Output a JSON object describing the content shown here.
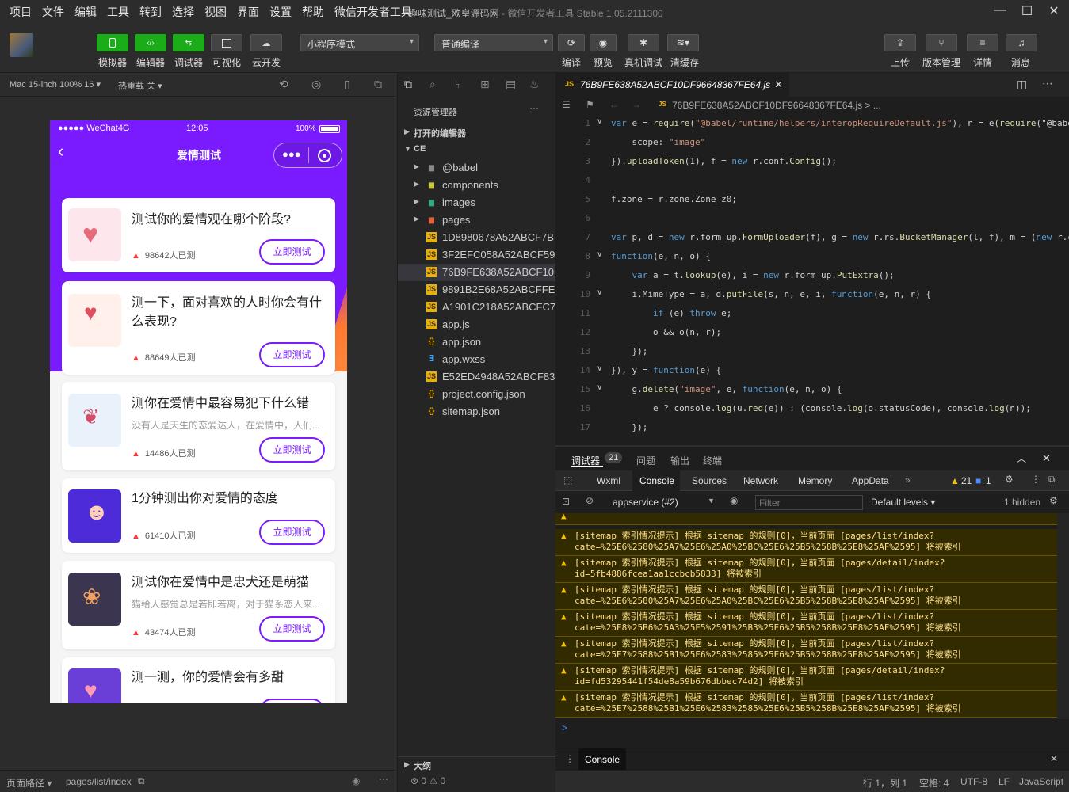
{
  "menu": [
    "项目",
    "文件",
    "编辑",
    "工具",
    "转到",
    "选择",
    "视图",
    "界面",
    "设置",
    "帮助",
    "微信开发者工具"
  ],
  "window": {
    "title": "趣味测试_欧皇源码网",
    "subtitle": " - 微信开发者工具 Stable 1.05.2111300"
  },
  "toolbar": {
    "left": [
      "模拟器",
      "编辑器",
      "调试器",
      "可视化",
      "云开发"
    ],
    "mode": "小程序模式",
    "compile_mode": "普通编译",
    "mid": [
      "编译",
      "预览",
      "真机调试",
      "清缓存"
    ],
    "right": [
      "上传",
      "版本管理",
      "详情",
      "消息"
    ]
  },
  "simbar": {
    "device": "Mac 15-inch 100% 16 ▾",
    "hotreload": "热重载 关 ▾"
  },
  "phone": {
    "carrier": "●●●●● WeChat4G",
    "time": "12:05",
    "battery": "100%",
    "nav_title": "爱情测试",
    "cards": [
      {
        "title": "测试你的爱情观在哪个阶段?",
        "sub": "",
        "count": "98642人已测",
        "btn": "立即测试"
      },
      {
        "title": "测一下，面对喜欢的人时你会有什么表现?",
        "sub": "",
        "count": "88649人已测",
        "btn": "立即测试"
      },
      {
        "title": "测你在爱情中最容易犯下什么错",
        "sub": "没有人是天生的恋爱达人，在爱情中，人们...",
        "count": "14486人已测",
        "btn": "立即测试"
      },
      {
        "title": "1分钟测出你对爱情的态度",
        "sub": "",
        "count": "61410人已测",
        "btn": "立即测试"
      },
      {
        "title": "测试你在爱情中是忠犬还是萌猫",
        "sub": "猫给人感觉总是若即若离，对于猫系恋人来...",
        "count": "43474人已测",
        "btn": "立即测试"
      },
      {
        "title": "测一测，你的爱情会有多甜",
        "sub": "",
        "count": "",
        "btn": ""
      }
    ]
  },
  "simfoot": {
    "label": "页面路径 ▾",
    "path": "pages/list/index"
  },
  "explorer": {
    "title": "资源管理器",
    "open_editors": "打开的编辑器",
    "root": "CE",
    "items": [
      {
        "name": "@babel",
        "type": "folder"
      },
      {
        "name": "components",
        "type": "folder"
      },
      {
        "name": "images",
        "type": "folder"
      },
      {
        "name": "pages",
        "type": "folder"
      },
      {
        "name": "1D8980678A52ABCF7B...",
        "type": "js"
      },
      {
        "name": "3F2EFC058A52ABCF59...",
        "type": "js"
      },
      {
        "name": "76B9FE638A52ABCF10...",
        "type": "js"
      },
      {
        "name": "9891B2E68A52ABCFFE...",
        "type": "js"
      },
      {
        "name": "A1901C218A52ABCFC7...",
        "type": "js"
      },
      {
        "name": "app.js",
        "type": "js"
      },
      {
        "name": "app.json",
        "type": "json"
      },
      {
        "name": "app.wxss",
        "type": "wxss"
      },
      {
        "name": "E52ED4948A52ABCF83...",
        "type": "js"
      },
      {
        "name": "project.config.json",
        "type": "json"
      },
      {
        "name": "sitemap.json",
        "type": "json"
      }
    ],
    "outline": "大纲",
    "status": "⊗ 0 ⚠ 0"
  },
  "editor": {
    "tab": "76B9FE638A52ABCF10DF96648367FE64.js",
    "crumb": "76B9FE638A52ABCF10DF96648367FE64.js > ...",
    "lines": [
      "var e = require(\"@babel/runtime/helpers/interopRequireDefault.js\"), n = e(require(\"@babe",
      "    scope: \"image\"",
      "}).uploadToken(1), f = new r.conf.Config();",
      "",
      "f.zone = r.zone.Zone_z0;",
      "",
      "var p, d = new r.form_up.FormUploader(f), g = new r.rs.BucketManager(l, f), m = (new r.c",
      "function(e, n, o) {",
      "    var a = t.lookup(e), i = new r.form_up.PutExtra();",
      "    i.MimeType = a, d.putFile(s, n, e, i, function(e, n, r) {",
      "        if (e) throw e;",
      "        o && o(n, r);",
      "    });",
      "}), y = function(e) {",
      "    g.delete(\"image\", e, function(e, n, o) {",
      "        e ? console.log(u.red(e)) : (console.log(o.statusCode), console.log(n));",
      "    });"
    ]
  },
  "debugger": {
    "tabs": [
      "调试器",
      "问题",
      "输出",
      "终端"
    ],
    "badge": "21",
    "devtabs": [
      "Wxml",
      "Console",
      "Sources",
      "Network",
      "Memory",
      "AppData"
    ],
    "warn_count": "21",
    "info_count": "1",
    "context": "appservice (#2)",
    "filter_placeholder": "Filter",
    "levels": "Default levels",
    "hidden": "1 hidden",
    "messages": [
      [
        "[sitemap 索引情况提示] 根据 sitemap 的规则[0]，当前页面 [pages/list/index?",
        "cate=%25E6%2580%25A7%25E6%25A0%25BC%25E6%25B5%258B%25E8%25AF%2595] 将被索引"
      ],
      [
        "[sitemap 索引情况提示] 根据 sitemap 的规则[0]，当前页面 [pages/detail/index?",
        "id=5fb4886fcea1aa1ccbcb5833] 将被索引"
      ],
      [
        "[sitemap 索引情况提示] 根据 sitemap 的规则[0]，当前页面 [pages/list/index?",
        "cate=%25E6%2580%25A7%25E6%25A0%25BC%25E6%25B5%258B%25E8%25AF%2595] 将被索引"
      ],
      [
        "[sitemap 索引情况提示] 根据 sitemap 的规则[0]，当前页面 [pages/list/index?",
        "cate=%25E8%25B6%25A3%25E5%2591%25B3%25E6%25B5%258B%25E8%25AF%2595] 将被索引"
      ],
      [
        "[sitemap 索引情况提示] 根据 sitemap 的规则[0]，当前页面 [pages/list/index?",
        "cate=%25E7%2588%25B1%25E6%2583%2585%25E6%25B5%258B%25E8%25AF%2595] 将被索引"
      ],
      [
        "[sitemap 索引情况提示] 根据 sitemap 的规则[0]，当前页面 [pages/detail/index?",
        "id=fd53295441f54de8a59b676dbbec74d2] 将被索引"
      ],
      [
        "[sitemap 索引情况提示] 根据 sitemap 的规则[0]，当前页面 [pages/list/index?",
        "cate=%25E7%2588%25B1%25E6%2583%2585%25E6%25B5%258B%25E8%25AF%2595] 将被索引"
      ]
    ],
    "prompt": ">",
    "drawer": "Console"
  },
  "statusbar": {
    "pos": "行 1，列 1",
    "spaces": "空格: 4",
    "enc": "UTF-8",
    "eol": "LF",
    "lang": "JavaScript"
  }
}
